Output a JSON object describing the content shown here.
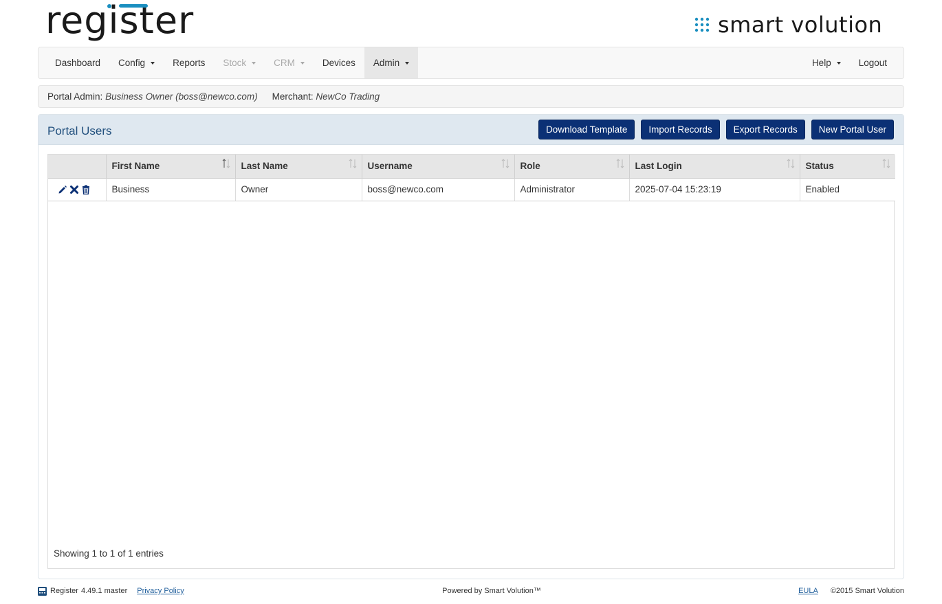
{
  "brand": {
    "app_logo_text": "register",
    "vendor_logo_text": "smart volution",
    "accent_color": "#1a8fc0",
    "button_color": "#0b3075"
  },
  "nav": {
    "left": [
      {
        "label": "Dashboard",
        "dropdown": false,
        "disabled": false,
        "active": false
      },
      {
        "label": "Config",
        "dropdown": true,
        "disabled": false,
        "active": false
      },
      {
        "label": "Reports",
        "dropdown": false,
        "disabled": false,
        "active": false
      },
      {
        "label": "Stock",
        "dropdown": true,
        "disabled": true,
        "active": false
      },
      {
        "label": "CRM",
        "dropdown": true,
        "disabled": true,
        "active": false
      },
      {
        "label": "Devices",
        "dropdown": false,
        "disabled": false,
        "active": false
      },
      {
        "label": "Admin",
        "dropdown": true,
        "disabled": false,
        "active": true
      }
    ],
    "right": [
      {
        "label": "Help",
        "dropdown": true
      },
      {
        "label": "Logout",
        "dropdown": false
      }
    ]
  },
  "info": {
    "portal_admin_label": "Portal Admin:",
    "portal_admin_value": "Business Owner (boss@newco.com)",
    "merchant_label": "Merchant:",
    "merchant_value": "NewCo Trading"
  },
  "panel": {
    "title": "Portal Users",
    "buttons": {
      "download_template": "Download Template",
      "import_records": "Import Records",
      "export_records": "Export Records",
      "new_portal_user": "New Portal User"
    }
  },
  "table": {
    "columns": [
      "First Name",
      "Last Name",
      "Username",
      "Role",
      "Last Login",
      "Status"
    ],
    "rows": [
      {
        "first_name": "Business",
        "last_name": "Owner",
        "username": "boss@newco.com",
        "role": "Administrator",
        "last_login": "2025-07-04 15:23:19",
        "status": "Enabled"
      }
    ],
    "showing": "Showing 1 to 1 of 1 entries"
  },
  "footer": {
    "app_name": "Register",
    "version": "4.49.1 master",
    "privacy_link": "Privacy Policy",
    "powered_by": "Powered by Smart Volution™",
    "eula_link": "EULA",
    "copyright": "©2015 Smart Volution"
  }
}
